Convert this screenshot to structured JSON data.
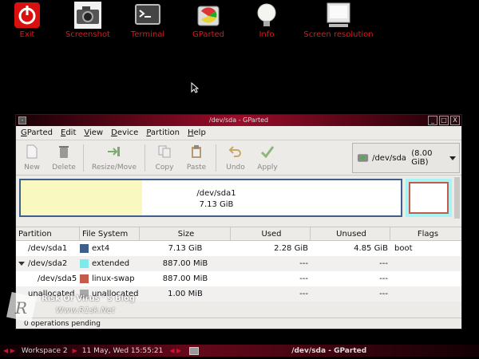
{
  "desktop": {
    "icons": [
      {
        "name": "exit-icon",
        "label": "Exit"
      },
      {
        "name": "camera-icon",
        "label": "Screenshot"
      },
      {
        "name": "terminal-icon",
        "label": "Terminal"
      },
      {
        "name": "gparted-icon",
        "label": "GParted"
      },
      {
        "name": "info-icon",
        "label": "Info"
      },
      {
        "name": "monitor-icon",
        "label": "Screen resolution"
      }
    ]
  },
  "window": {
    "title": "/dev/sda - GParted",
    "menu_button": "-",
    "controls": [
      "_",
      "□",
      "X"
    ]
  },
  "menubar": {
    "items": [
      {
        "first": "G",
        "rest": "Parted"
      },
      {
        "first": "E",
        "rest": "dit"
      },
      {
        "first": "V",
        "rest": "iew"
      },
      {
        "first": "D",
        "rest": "evice"
      },
      {
        "first": "P",
        "rest": "artition"
      },
      {
        "first": "H",
        "rest": "elp"
      }
    ]
  },
  "toolbar": {
    "new": "New",
    "delete": "Delete",
    "resize_move": "Resize/Move",
    "copy": "Copy",
    "paste": "Paste",
    "undo": "Undo",
    "apply": "Apply",
    "device": "/dev/sda",
    "device_size": "(8.00 GiB)"
  },
  "partition_map": {
    "main_name": "/dev/sda1",
    "main_size": "7.13 GiB",
    "used_fraction": 0.32
  },
  "table": {
    "headers": [
      "Partition",
      "File System",
      "Size",
      "Used",
      "Unused",
      "Flags"
    ],
    "rows": [
      {
        "partition": "/dev/sda1",
        "fs": "ext4",
        "fs_color": "#3e5f8a",
        "size": "7.13 GiB",
        "used": "2.28 GiB",
        "unused": "4.85 GiB",
        "flags": "boot"
      },
      {
        "partition": "/dev/sda2",
        "fs": "extended",
        "fs_color": "#7eeaea",
        "size": "887.00 MiB",
        "used": "---",
        "unused": "---",
        "flags": ""
      },
      {
        "partition": "/dev/sda5",
        "fs": "linux-swap",
        "fs_color": "#c35a4a",
        "size": "887.00 MiB",
        "used": "---",
        "unused": "---",
        "flags": ""
      },
      {
        "partition": "unallocated",
        "fs": "unallocated",
        "fs_color": "#a8a8a8",
        "size": "1.00 MiB",
        "used": "---",
        "unused": "---",
        "flags": ""
      }
    ]
  },
  "statusbar": {
    "text": "0 operations pending"
  },
  "watermark": {
    "line1": "Risk Of Virus ' s Blog",
    "line2": "Www.R1sk.Net"
  },
  "taskbar": {
    "arrows_left": "◀ ▶",
    "workspace": "Workspace 2",
    "datetime": "11 May, Wed 15:55:21",
    "arrows_right": "◀ ▶",
    "task_title": "/dev/sda - GParted"
  }
}
